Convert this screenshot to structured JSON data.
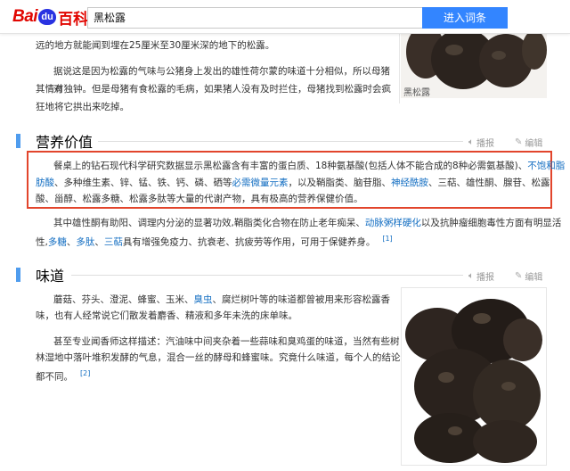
{
  "header": {
    "logo_bai": "Bai",
    "logo_du": "du",
    "logo_baike": "百科",
    "search_value": "黑松露",
    "search_button": "进入词条"
  },
  "intro": {
    "line1": "远的地方就能闻到埋在25厘米至30厘米深的地下的松露。",
    "p2_line1": "据说这是因为松露的气味与公猪身上发出的雄性荷尔蒙的味道十分相似，所以母猪对",
    "p2_line2": "其情有独钟。但是母猪有食松露的毛病，如果猪人没有及时拦住，母猪找到松露时会疯",
    "p2_line3": "狂地将它拱出来吃掉。"
  },
  "top_image": {
    "caption": "黑松露"
  },
  "section_nutrition": {
    "title": "营养价值",
    "edit_audio": "播报",
    "edit_label": "编辑",
    "p1_line1_a": "餐桌上的钻石现代科学研究数据显示黑松露含有丰富的蛋白质、18种氨基酸(包括人体不能合成的8种必需氨基酸)、",
    "p1_line1_link": "不饱和脂",
    "p1_line2_link1": "肪酸",
    "p1_line2_a": "、多种维生素、锌、锰、铁、钙、磷、硒等",
    "p1_line2_link2": "必需微量元素",
    "p1_line2_b": "，以及鞘脂类、脑苷脂、",
    "p1_line2_link3": "神经酰胺",
    "p1_line2_c": "、三萜、雄性酮、腺苷、松露",
    "p1_line3": "酸、甾醇、松露多糖、松露多肽等大量的代谢产物，具有极高的营养保健价值。",
    "p2_line1_a": "其中雄性酮有助阳、调理内分泌的显著功效,鞘脂类化合物在防止老年痴呆、",
    "p2_line1_link": "动脉粥样硬化",
    "p2_line1_b": "以及抗肿瘤细胞毒性方面有明显活",
    "p2_line2_a": "性,",
    "p2_line2_link1": "多糖",
    "p2_line2_sep1": "、",
    "p2_line2_link2": "多肽",
    "p2_line2_sep2": "、",
    "p2_line2_link3": "三萜",
    "p2_line2_b": "具有增强免疫力、抗衰老、抗疲劳等作用，可用于保健养身。",
    "ref": "[1]"
  },
  "section_taste": {
    "title": "味道",
    "edit_audio": "播报",
    "edit_label": "编辑",
    "p1_line1_a": "蘑菇、芬头、澄泥、蜂蜜、玉米、",
    "p1_line1_link": "臭虫",
    "p1_line1_b": "、腐烂树叶等的味道都曾被用来形容松露香",
    "p1_line2": "味，也有人经常说它们散发着麝香、精液和多年未洗的床单味。",
    "p2_line1": "甚至专业闻香师这样描述：汽油味中间夹杂着一些蒜味和臭鸡蛋的味道，当然有些树",
    "p2_line2": "林湿地中落叶堆积发酵的气息，混合一丝的酵母和蜂蜜味。究竟什么味道，每个人的结论",
    "p2_line3": "都不同。",
    "ref": "[2]"
  },
  "colors": {
    "accent": "#3385ff",
    "link": "#136ec2",
    "highlight_border": "#e2452c",
    "section_bar": "#4f9cee"
  }
}
